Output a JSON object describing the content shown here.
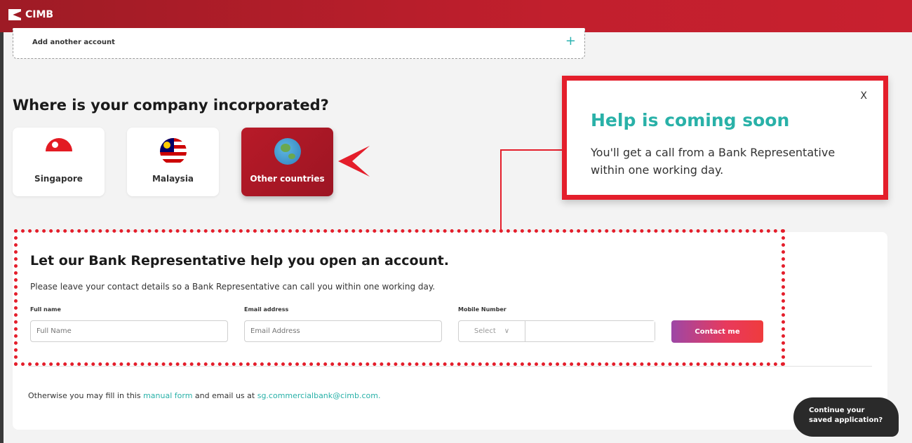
{
  "header": {
    "brand": "CIMB"
  },
  "add_account": {
    "label": "Add another account",
    "plus_icon": "+"
  },
  "question": "Where is your company incorporated?",
  "countries": [
    {
      "name": "Singapore",
      "icon": "singapore-flag-icon",
      "selected": false
    },
    {
      "name": "Malaysia",
      "icon": "malaysia-flag-icon",
      "selected": false
    },
    {
      "name": "Other countries",
      "icon": "globe-icon",
      "selected": true
    }
  ],
  "help_popup": {
    "close": "X",
    "title": "Help is coming soon",
    "text": "You'll get a call from a Bank Representative within one working day."
  },
  "rep_form": {
    "title": "Let our Bank Representative help you open an account.",
    "subtitle": "Please leave your contact details so a Bank Representative can call you within one working day.",
    "full_name_label": "Full name",
    "full_name_placeholder": "Full Name",
    "email_label": "Email address",
    "email_placeholder": "Email Address",
    "mobile_label": "Mobile Number",
    "mobile_select": "Select",
    "mobile_chevron": "∨",
    "submit": "Contact me"
  },
  "footer_note": {
    "prefix": "Otherwise you may fill in this ",
    "link_form": "manual form",
    "middle": " and email us at ",
    "link_email": "sg.commercialbank@cimb.com."
  },
  "continue_button": {
    "line1": "Continue your",
    "line2": "saved application?"
  },
  "colors": {
    "brand_red": "#c11f2d",
    "accent_teal": "#29b1a8",
    "highlight_red": "#e41e2b"
  }
}
